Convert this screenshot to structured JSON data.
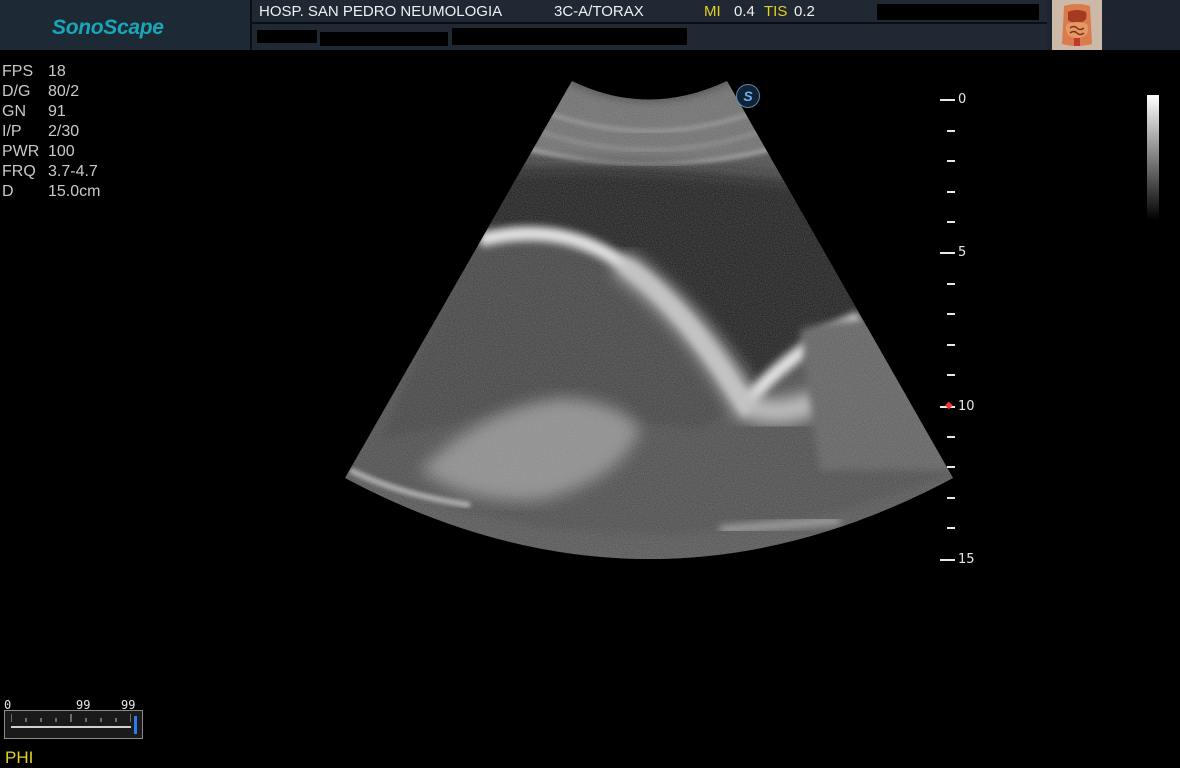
{
  "header": {
    "brand": "SonoScape",
    "hospital": "HOSP. SAN PEDRO NEUMOLOGIA",
    "probe_preset": "3C-A/TORAX",
    "mi_label": "MI",
    "mi_value": "0.4",
    "tis_label": "TIS",
    "tis_value": "0.2"
  },
  "params": [
    {
      "label": "FPS",
      "value": "18"
    },
    {
      "label": "D/G",
      "value": "80/2"
    },
    {
      "label": "GN",
      "value": "91"
    },
    {
      "label": "I/P",
      "value": "2/30"
    },
    {
      "label": "PWR",
      "value": "100"
    },
    {
      "label": "FRQ",
      "value": "3.7-4.7"
    },
    {
      "label": "D",
      "value": "15.0cm"
    }
  ],
  "depth_scale": {
    "labels": [
      "0",
      "5",
      "10",
      "15"
    ],
    "focus_depth": 10
  },
  "slider": {
    "min_label": "0",
    "mid_label": "99",
    "max_label": "99"
  },
  "mode_label": "PHI",
  "probe_badge": "S",
  "colors": {
    "header_bg": "#1f2833",
    "brand": "#17a7b8",
    "highlight_label": "#e6d11c",
    "slider_thumb": "#2a7bf0"
  }
}
